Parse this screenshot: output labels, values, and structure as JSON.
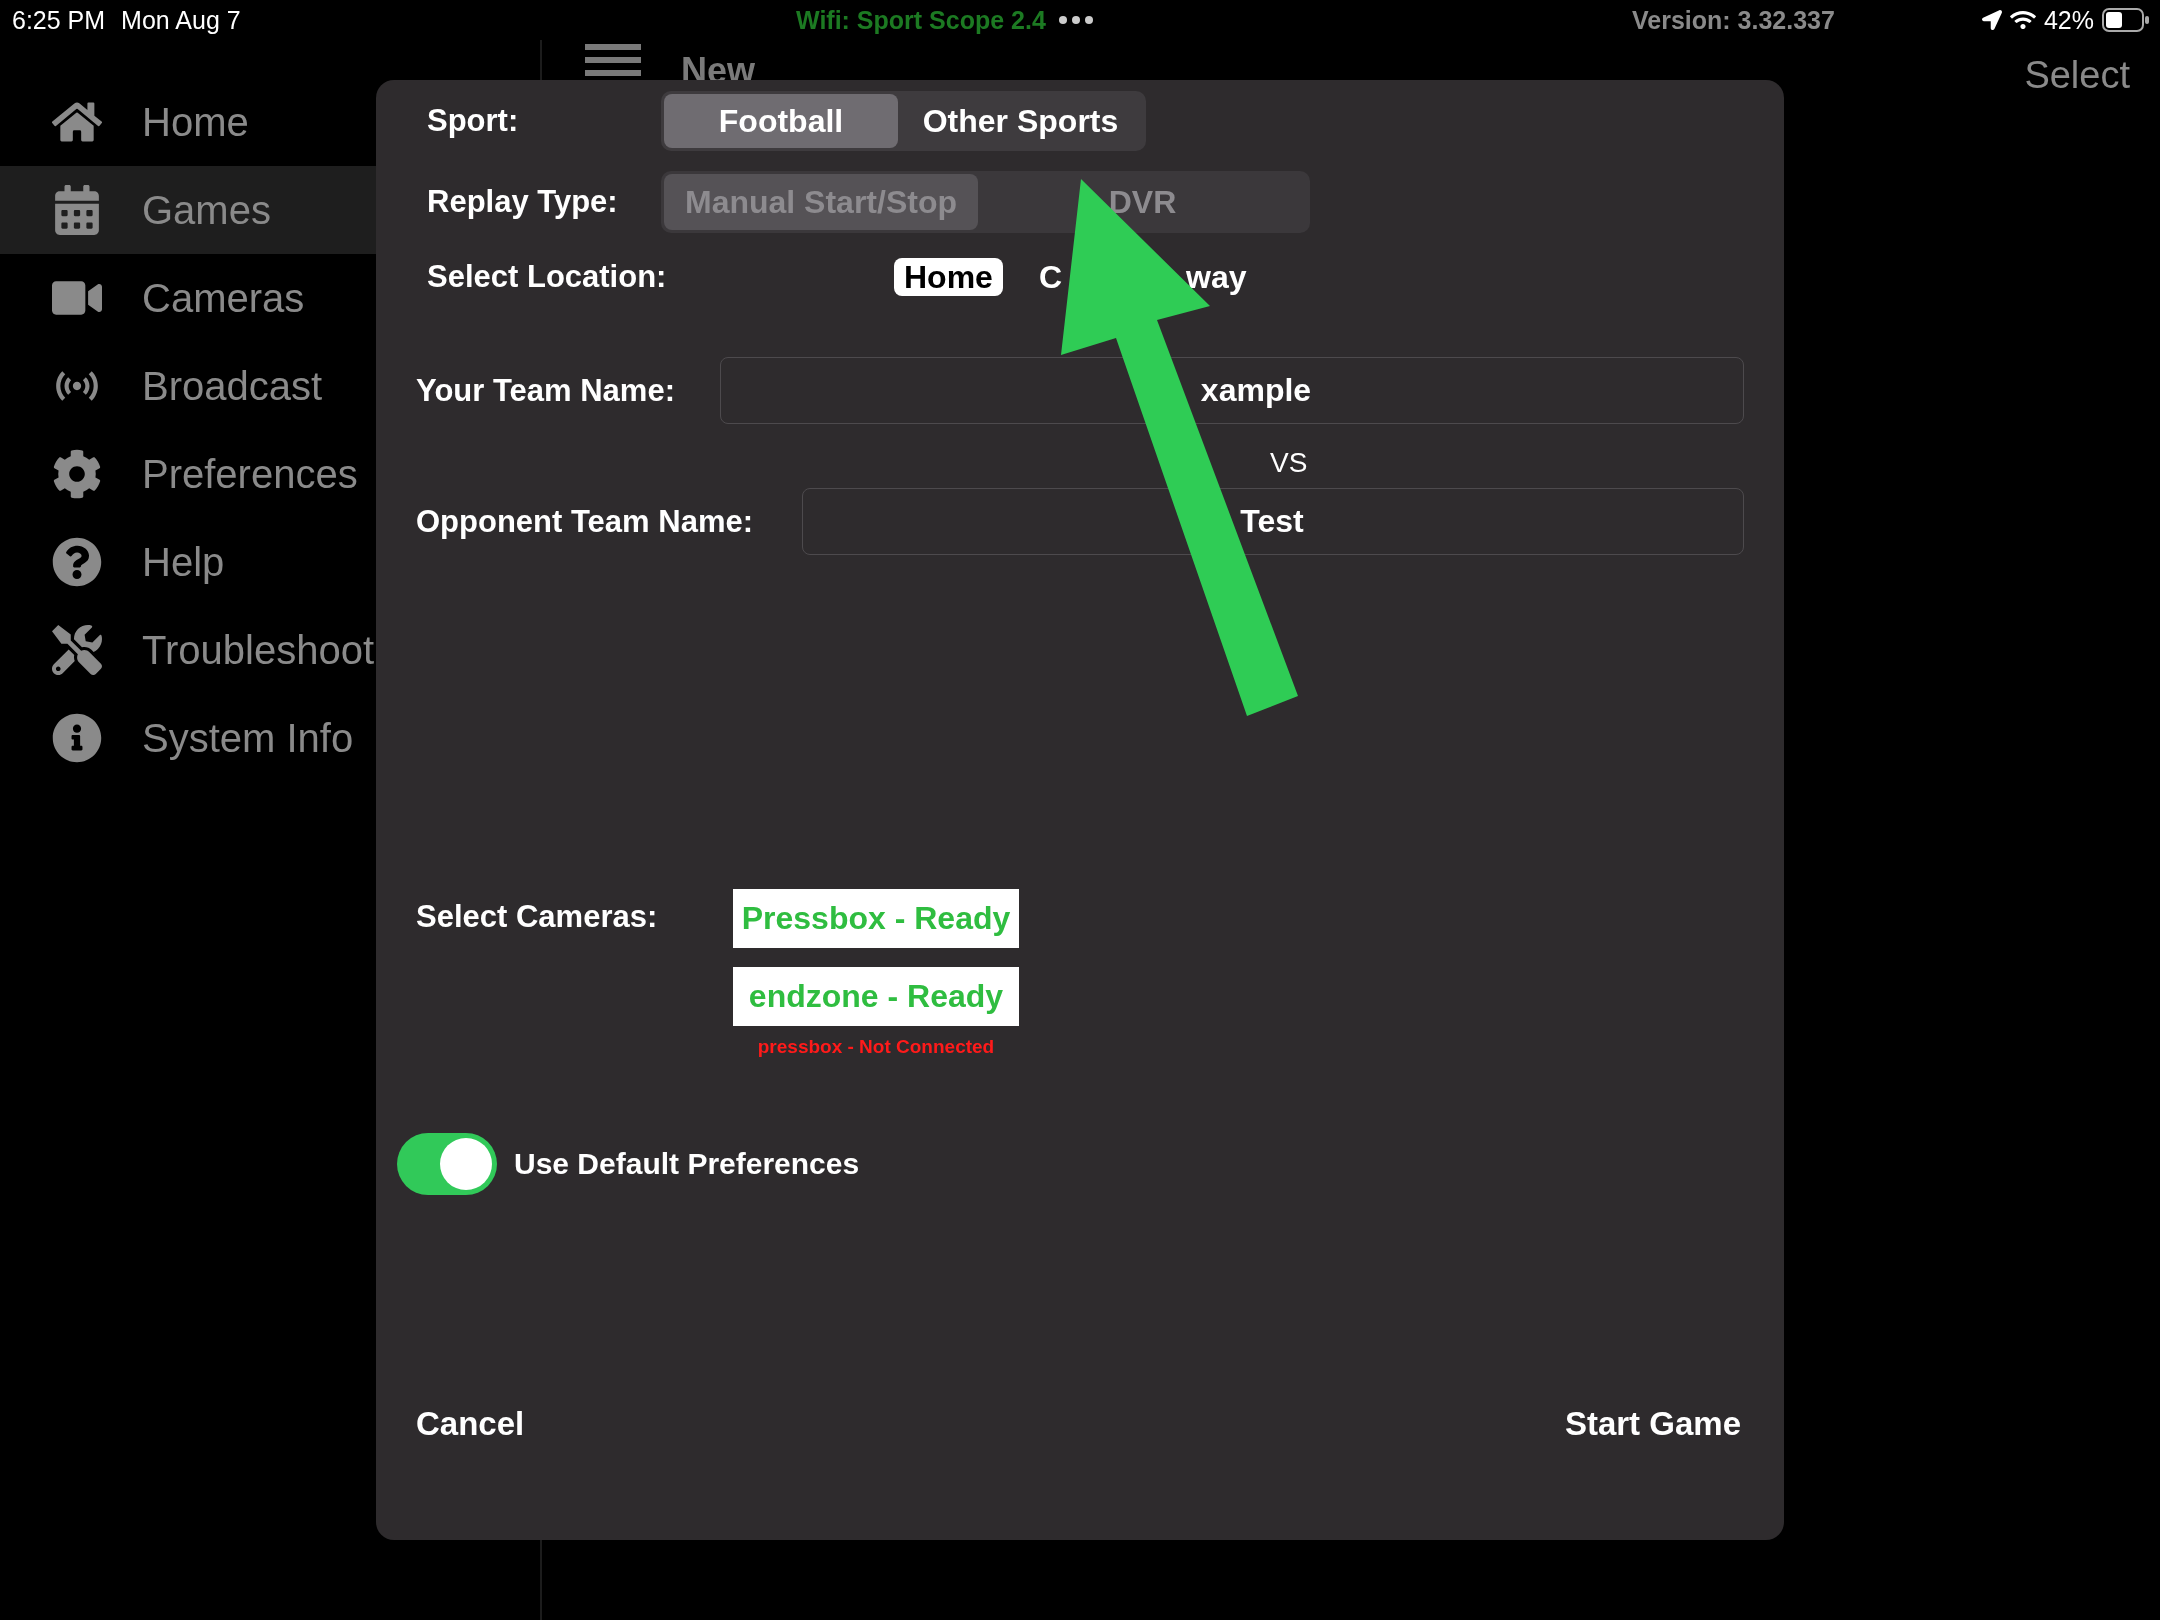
{
  "status_bar": {
    "time": "6:25 PM",
    "date": "Mon Aug 7",
    "network": "Wifi: Sport Scope 2.4",
    "version": "Version: 3.32.337",
    "battery": "42%"
  },
  "header": {
    "title": "New",
    "action": "Select"
  },
  "sidebar": {
    "items": [
      {
        "label": "Home",
        "selected": false
      },
      {
        "label": "Games",
        "selected": true
      },
      {
        "label": "Cameras",
        "selected": false
      },
      {
        "label": "Broadcast",
        "selected": false
      },
      {
        "label": "Preferences",
        "selected": false
      },
      {
        "label": "Help",
        "selected": false
      },
      {
        "label": "Troubleshoot",
        "selected": false
      },
      {
        "label": "System Info",
        "selected": false
      }
    ]
  },
  "dialog": {
    "sport": {
      "label": "Sport:",
      "options": [
        {
          "label": "Football",
          "selected": true
        },
        {
          "label": "Other Sports",
          "selected": false
        }
      ]
    },
    "replay_type": {
      "label": "Replay Type:",
      "disabled": true,
      "options": [
        {
          "label": "Manual Start/Stop",
          "selected": true
        },
        {
          "label": "DVR",
          "selected": false
        }
      ]
    },
    "location": {
      "label": "Select Location:",
      "options": [
        {
          "label": "Home",
          "selected": true
        },
        {
          "label_fragments": [
            "C",
            "way"
          ],
          "selected": false
        }
      ]
    },
    "your_team": {
      "label": "Your Team Name:",
      "value": "xample"
    },
    "separator": "VS",
    "opponent": {
      "label": "Opponent Team Name:",
      "value": "Test"
    },
    "cameras": {
      "label": "Select Cameras:",
      "items": [
        {
          "kind": "ready",
          "label": "Pressbox - Ready"
        },
        {
          "kind": "ready",
          "label": "endzone - Ready"
        },
        {
          "kind": "offline",
          "label": "pressbox  - Not Connected"
        }
      ]
    },
    "default_preferences": {
      "label": "Use Default Preferences",
      "on": true
    },
    "cancel": "Cancel",
    "start": "Start Game"
  }
}
